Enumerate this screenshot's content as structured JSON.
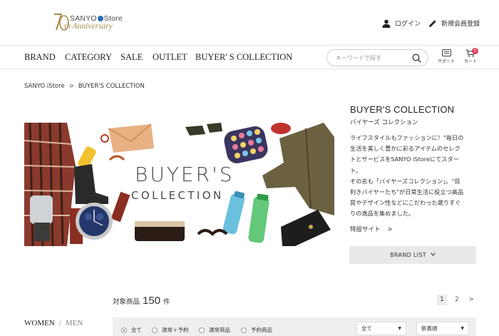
{
  "header": {
    "logo_brand": "SANYO",
    "logo_store": "Store",
    "logo_anniversary": "th Anniversary",
    "logo_numeral": "70",
    "login_label": "ログイン",
    "register_label": "新規会員登録"
  },
  "nav": {
    "items": [
      "BRAND",
      "CATEGORY",
      "SALE",
      "OUTLET",
      "BUYER' S COLLECTION"
    ],
    "search_placeholder": "キーワードで探す",
    "support_label": "サポート",
    "cart_label": "カート",
    "cart_count": "0"
  },
  "breadcrumb": {
    "home": "SANYO iStore",
    "separator": ">",
    "current": "BUYER'S COLLECTION"
  },
  "banner": {
    "line1": "BUYER'S",
    "line2": "COLLECTION"
  },
  "side": {
    "title": "BUYER'S COLLECTION",
    "subtitle": "バイヤーズ コレクション",
    "description_lines": [
      "ライフスタイルもファッションに！\"毎日の",
      "生活を美しく豊かに彩るアイテムのセレク",
      "トとサービスをSANYO iStoreにてスター",
      "ト。",
      "その名も「バイヤーズコレクション」。\"目",
      "利きバイヤーたち\"が日常生活に役立つ高品",
      "質やデザイン性などにこだわった選りすぐ",
      "りの逸品を集めました。"
    ],
    "link_label": "特設サイト",
    "link_arrow": ">",
    "brandlist_label": "BRAND LIST"
  },
  "results": {
    "label": "対象商品",
    "count": "150",
    "unit": "件",
    "pages": [
      "1",
      "2"
    ],
    "next": ">"
  },
  "gender": {
    "women": "WOMEN",
    "separator": "/",
    "men": "MEN"
  },
  "filters": {
    "radios": [
      "全て",
      "通常＋予約",
      "通常商品",
      "予約商品"
    ],
    "selected_index": 0,
    "select1_value": "全て",
    "select2_value": "新着順"
  },
  "colors": {
    "gold": "#a88a4a",
    "accent_blue": "#2d6db5",
    "badge_red": "#e0395a",
    "panel_gray": "#e9e9e9"
  }
}
